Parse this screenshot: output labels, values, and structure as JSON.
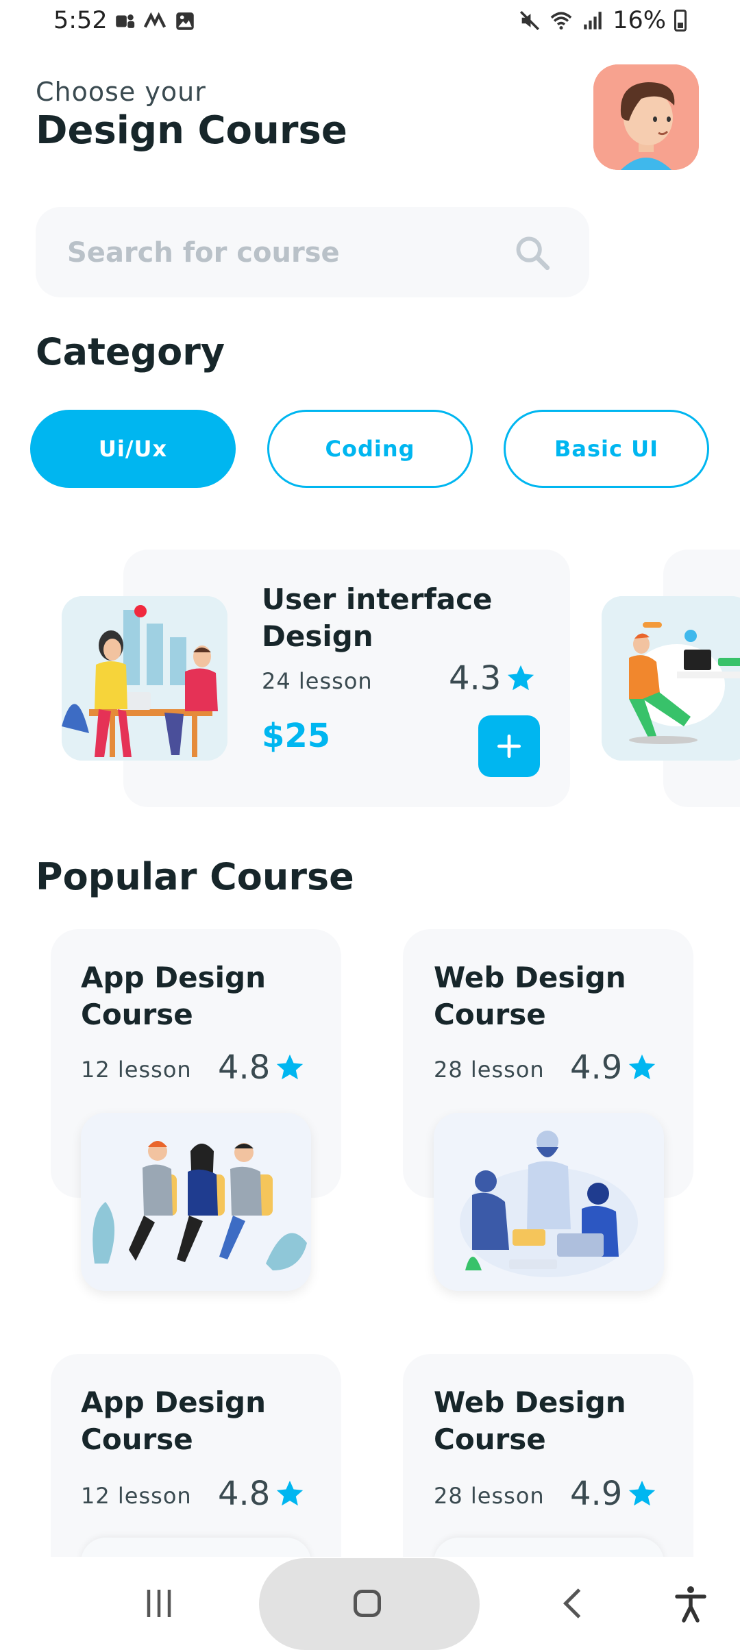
{
  "status_bar": {
    "time": "5:52",
    "battery": "16%",
    "icons_left": [
      "teams-icon",
      "m-icon",
      "image-icon"
    ],
    "icons_right": [
      "mute-icon",
      "wifi-icon",
      "signal-icon",
      "battery-icon"
    ]
  },
  "header": {
    "subtitle": "Choose your",
    "title": "Design Course"
  },
  "search": {
    "placeholder": "Search for course"
  },
  "category": {
    "title": "Category",
    "chips": [
      "Ui/Ux",
      "Coding",
      "Basic UI"
    ],
    "active_index": 0
  },
  "featured": {
    "name": "User interface Design",
    "lessons": "24 lesson",
    "rating": "4.3",
    "price": "$25"
  },
  "popular": {
    "title": "Popular Course",
    "courses": [
      {
        "name": "App Design Course",
        "lessons": "12 lesson",
        "rating": "4.8"
      },
      {
        "name": "Web Design Course",
        "lessons": "28 lesson",
        "rating": "4.9"
      },
      {
        "name": "App Design Course",
        "lessons": "12 lesson",
        "rating": "4.8"
      },
      {
        "name": "Web Design Course",
        "lessons": "28 lesson",
        "rating": "4.9"
      }
    ]
  },
  "colors": {
    "accent": "#00b6f0",
    "text_dark": "#17262a",
    "card_bg": "#f7f8fa"
  }
}
